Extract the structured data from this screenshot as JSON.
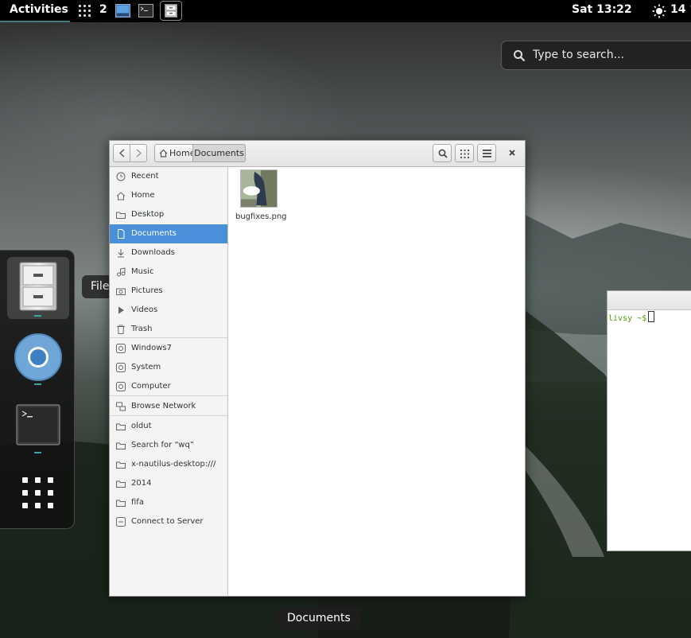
{
  "topbar": {
    "activities": "Activities",
    "workspace_number": "2",
    "clock": "Sat 13:22",
    "weather_temp": "14 °"
  },
  "search": {
    "placeholder": "Type to search..."
  },
  "dash": {
    "tooltip": "Files",
    "apps": [
      {
        "name": "files",
        "icon": "file-cabinet-icon",
        "running": true
      },
      {
        "name": "chromium",
        "icon": "chromium-icon",
        "running": true
      },
      {
        "name": "terminal",
        "icon": "terminal-icon",
        "running": true
      },
      {
        "name": "show-apps",
        "icon": "app-grid-icon",
        "running": false
      }
    ]
  },
  "nautilus": {
    "breadcrumbs": [
      "Home",
      "Documents"
    ],
    "sidebar": [
      {
        "label": "Recent",
        "icon": "clock-icon"
      },
      {
        "label": "Home",
        "icon": "home-icon"
      },
      {
        "label": "Desktop",
        "icon": "folder-icon"
      },
      {
        "label": "Documents",
        "icon": "document-icon",
        "selected": true
      },
      {
        "label": "Downloads",
        "icon": "download-icon"
      },
      {
        "label": "Music",
        "icon": "music-icon"
      },
      {
        "label": "Pictures",
        "icon": "camera-icon"
      },
      {
        "label": "Videos",
        "icon": "video-icon"
      },
      {
        "label": "Trash",
        "icon": "trash-icon"
      },
      {
        "label": "Windows7",
        "icon": "drive-icon"
      },
      {
        "label": "System",
        "icon": "drive-icon"
      },
      {
        "label": "Computer",
        "icon": "drive-icon"
      },
      {
        "label": "Browse Network",
        "icon": "network-icon"
      },
      {
        "label": "oldut",
        "icon": "folder-icon"
      },
      {
        "label": "Search for “wq”",
        "icon": "folder-icon"
      },
      {
        "label": "x-nautilus-desktop:///",
        "icon": "folder-icon"
      },
      {
        "label": "2014",
        "icon": "folder-icon"
      },
      {
        "label": "fifa",
        "icon": "folder-icon"
      },
      {
        "label": "Connect to Server",
        "icon": "server-icon"
      }
    ],
    "files": [
      {
        "name": "bugfixes.png"
      }
    ]
  },
  "terminal": {
    "prompt": "livsy ~$"
  },
  "window_caption": "Documents",
  "colors": {
    "accent": "#4a90d9",
    "running_indicator": "#3aa5a0",
    "topbar": "#000000"
  }
}
